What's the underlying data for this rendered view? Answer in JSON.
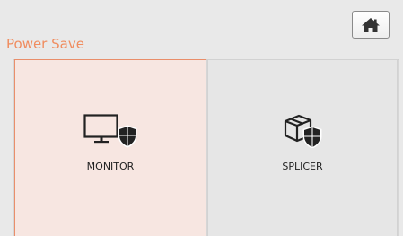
{
  "header": {
    "title": "Power Save",
    "home_button_icon": "home-icon"
  },
  "tiles": [
    {
      "label": "MONITOR",
      "icon": "monitor-shield-icon",
      "selected": true
    },
    {
      "label": "SPLICER",
      "icon": "box-shield-icon",
      "selected": false
    }
  ],
  "colors": {
    "title": "#f08c5e",
    "selected_border": "#e98e6a",
    "selected_bg": "#f7e6e1",
    "tile_bg": "#e6e6e6",
    "background": "#e9e9e9"
  }
}
